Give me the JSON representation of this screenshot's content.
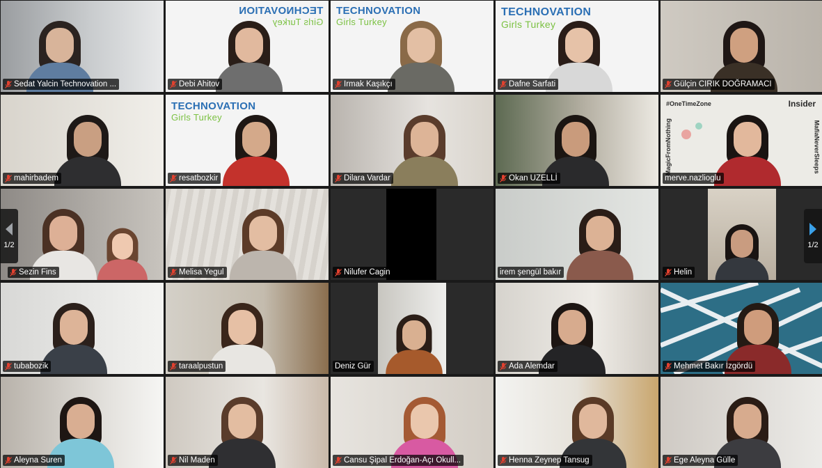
{
  "gallery": {
    "page_indicator_left": "1/2",
    "page_indicator_right": "1/2",
    "tiles": [
      {
        "name": "Sedat Yalcin Technovation ..."
      },
      {
        "name": "Debi Ahitov"
      },
      {
        "name": "Irmak Kaşıkçı"
      },
      {
        "name": "Dafne Sarfati"
      },
      {
        "name": "Gülçin CIRIK DOĞRAMACI"
      },
      {
        "name": "mahirbadem"
      },
      {
        "name": "resatbozkir"
      },
      {
        "name": "Dilara Vardar"
      },
      {
        "name": "Okan UZELLİ"
      },
      {
        "name": "merve.nazlioglu"
      },
      {
        "name": "Sezin Fins"
      },
      {
        "name": "Melisa Yegul"
      },
      {
        "name": "Nilufer Cagin"
      },
      {
        "name": "irem şengül bakır"
      },
      {
        "name": "Helin"
      },
      {
        "name": "tubabozik"
      },
      {
        "name": "taraalpustun"
      },
      {
        "name": "Deniz Gür"
      },
      {
        "name": "Ada Alemdar"
      },
      {
        "name": "Mehmet Bakır İzgördü"
      },
      {
        "name": "Aleyna Suren"
      },
      {
        "name": "Nil Maden"
      },
      {
        "name": "Cansu Şipal Erdoğan-Açı Okull..."
      },
      {
        "name": "Henna Zeynep Tansug"
      },
      {
        "name": "Ege Aleyna Gülle"
      }
    ]
  },
  "branding": {
    "logo_line1": "TECHNOVATION",
    "logo_line2": "Girls Turkey",
    "banner_hashtag": "#OneTimeZone",
    "banner_brand": "Insider",
    "banner_left": "MagicFromNothing",
    "banner_right": "MafiaNeverSleeps"
  },
  "colors": {
    "active_speaker_border": "#e8e36a",
    "muted_mic": "#e0412f",
    "tile_bg": "#3a3a3a",
    "app_bg": "#1a1a1a"
  }
}
